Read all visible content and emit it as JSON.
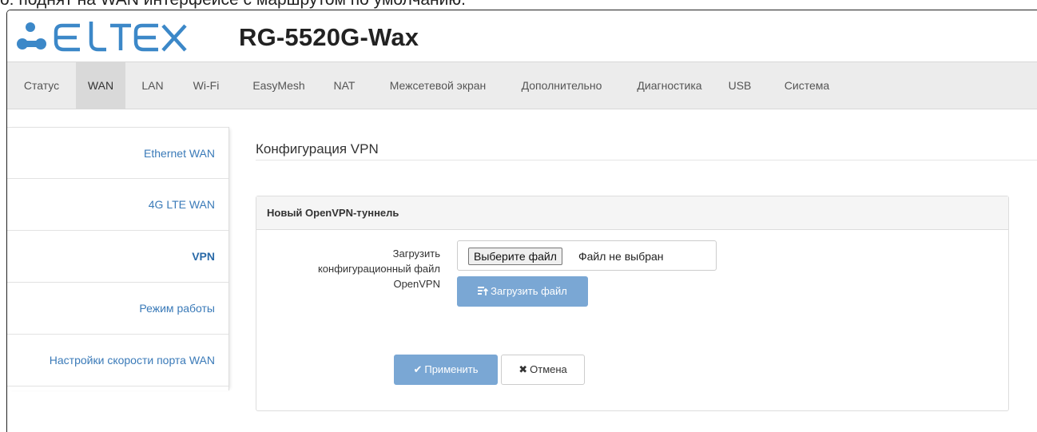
{
  "caption_fragment": "о: поднят на WAN интерфейсе с маршрутом по умолчанию.",
  "brand": {
    "logo_text": "ELTEX",
    "model": "RG-5520G-Wax",
    "logo_color": "#3c88c8"
  },
  "nav": {
    "items": [
      {
        "label": "Статус",
        "active": false
      },
      {
        "label": "WAN",
        "active": true
      },
      {
        "label": "LAN",
        "active": false
      },
      {
        "label": "Wi-Fi",
        "active": false
      },
      {
        "label": "EasyMesh",
        "active": false
      },
      {
        "label": "NAT",
        "active": false
      },
      {
        "label": "Межсетевой экран",
        "active": false
      },
      {
        "label": "Дополнительно",
        "active": false
      },
      {
        "label": "Диагностика",
        "active": false
      },
      {
        "label": "USB",
        "active": false
      },
      {
        "label": "Система",
        "active": false
      }
    ]
  },
  "sidebar": {
    "items": [
      {
        "label": "Ethernet WAN",
        "active": false
      },
      {
        "label": "4G LTE WAN",
        "active": false
      },
      {
        "label": "VPN",
        "active": true
      },
      {
        "label": "Режим работы",
        "active": false
      },
      {
        "label": "Настройки скорости порта WAN",
        "active": false
      }
    ]
  },
  "main": {
    "title": "Конфигурация VPN",
    "panel": {
      "heading": "Новый OpenVPN-туннель",
      "field_label_lines": [
        "Загрузить",
        "конфигурационный файл",
        "OpenVPN"
      ],
      "file_button": "Выберите файл",
      "file_status": "Файл не выбран",
      "upload_button": "Загрузить файл",
      "upload_icon": "upload-list-icon",
      "apply_button": "Применить",
      "apply_icon": "check-icon",
      "cancel_button": "Отмена",
      "cancel_icon": "close-icon"
    }
  },
  "colors": {
    "primary_button": "#7aa7d4",
    "link": "#3a7ab8",
    "nav_bg": "#ececec"
  }
}
